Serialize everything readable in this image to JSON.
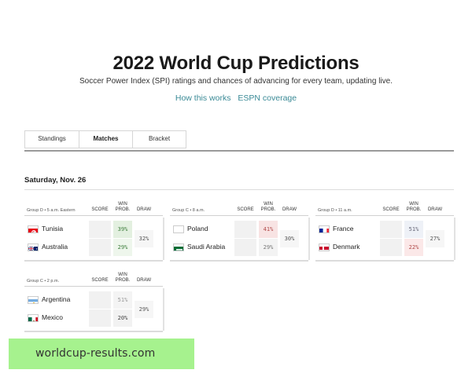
{
  "header": {
    "title": "2022 World Cup Predictions",
    "subtitle": "Soccer Power Index (SPI) ratings and chances of advancing for every team, updating live.",
    "link_how": "How this works",
    "link_espn": "ESPN coverage"
  },
  "tabs": [
    "Standings",
    "Matches",
    "Bracket"
  ],
  "active_tab": "Matches",
  "date": "Saturday, Nov. 26",
  "columns": {
    "score": "SCORE",
    "win_line1": "WIN",
    "win_line2": "PROB.",
    "draw": "DRAW"
  },
  "matches": [
    {
      "group": "Group D • 5 a.m. Eastern",
      "draw": "32%",
      "teams": [
        {
          "name": "Tunisia",
          "win": "39%",
          "flag": "tunisia-flag-icon",
          "win_bg": "#e3f0e0",
          "win_color": "#3c7d3a"
        },
        {
          "name": "Australia",
          "win": "29%",
          "flag": "australia-flag-icon",
          "win_bg": "#eef6ec",
          "win_color": "#3c7d3a"
        }
      ]
    },
    {
      "group": "Group C • 8 a.m.",
      "draw": "30%",
      "teams": [
        {
          "name": "Poland",
          "win": "41%",
          "flag": "poland-flag-icon",
          "win_bg": "#f8e3e3",
          "win_color": "#b04848"
        },
        {
          "name": "Saudi Arabia",
          "win": "29%",
          "flag": "saudi-arabia-flag-icon",
          "win_bg": "#f3f3f3",
          "win_color": "#777777"
        }
      ]
    },
    {
      "group": "Group D • 11 a.m.",
      "draw": "27%",
      "teams": [
        {
          "name": "France",
          "win": "51%",
          "flag": "france-flag-icon",
          "win_bg": "#eef1f7",
          "win_color": "#667"
        },
        {
          "name": "Denmark",
          "win": "22%",
          "flag": "denmark-flag-icon",
          "win_bg": "#fbe8e8",
          "win_color": "#b04848"
        }
      ]
    },
    {
      "group": "Group C • 2 p.m.",
      "draw": "29%",
      "teams": [
        {
          "name": "Argentina",
          "win": "51%",
          "flag": "argentina-flag-icon",
          "win_bg": "#f4f4f4",
          "win_color": "#999999"
        },
        {
          "name": "Mexico",
          "win": "20%",
          "flag": "mexico-flag-icon",
          "win_bg": "#f2f2f2",
          "win_color": "#444444"
        }
      ]
    }
  ],
  "watermark": "worldcup-results.com"
}
